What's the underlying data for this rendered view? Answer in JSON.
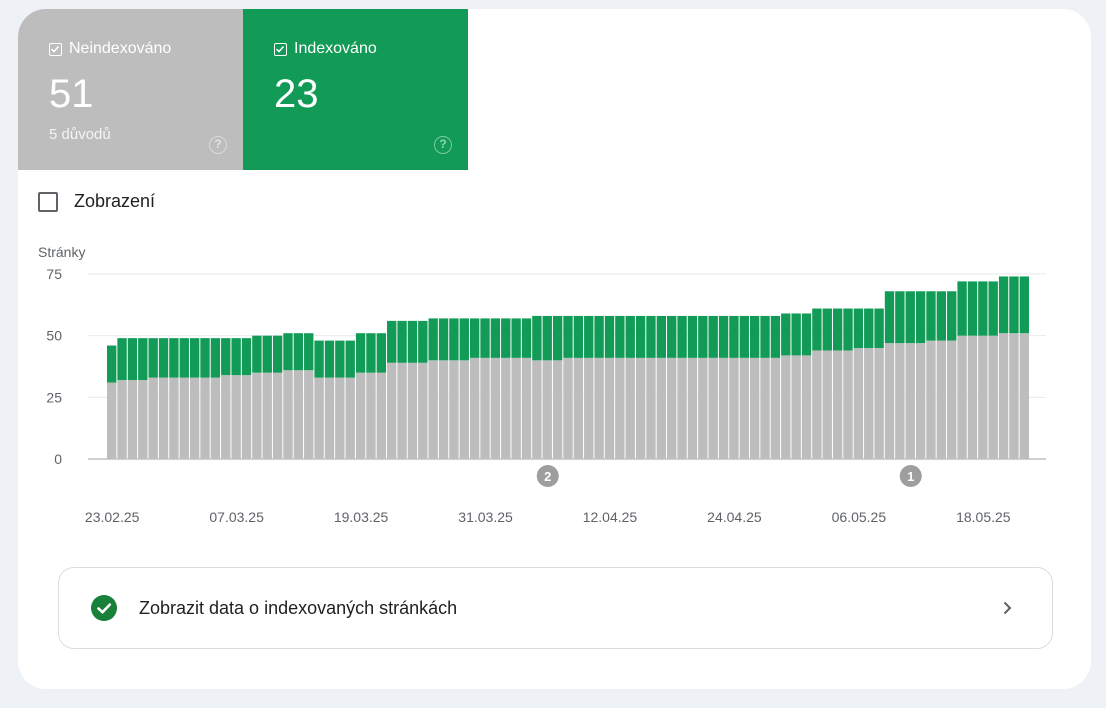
{
  "tiles": {
    "not_indexed": {
      "label": "Neindexováno",
      "value": "51",
      "sub": "5 důvodů",
      "help": "?",
      "checked": true
    },
    "indexed": {
      "label": "Indexováno",
      "value": "23",
      "help": "?",
      "checked": true
    }
  },
  "impressions_toggle": {
    "label": "Zobrazení",
    "checked": false
  },
  "colors": {
    "not_indexed": "#bdbdbd",
    "indexed": "#129b57",
    "grid": "#e8eaed",
    "axis": "#9aa0a6",
    "marker": "#9e9e9e"
  },
  "chart_data": {
    "type": "bar",
    "stacked": true,
    "ylabel": "Stránky",
    "ylim": [
      0,
      75
    ],
    "yticks": [
      0,
      25,
      50,
      75
    ],
    "xtick_labels": [
      "23.02.25",
      "07.03.25",
      "19.03.25",
      "31.03.25",
      "12.04.25",
      "24.04.25",
      "06.05.25",
      "18.05.25"
    ],
    "first_date": "2025-02-23",
    "last_date": "2025-05-21",
    "series": [
      {
        "name": "Neindexováno",
        "values": [
          31,
          32,
          32,
          32,
          33,
          33,
          33,
          33,
          33,
          33,
          33,
          34,
          34,
          34,
          35,
          35,
          35,
          36,
          36,
          36,
          33,
          33,
          33,
          33,
          35,
          35,
          35,
          39,
          39,
          39,
          39,
          40,
          40,
          40,
          40,
          41,
          41,
          41,
          41,
          41,
          41,
          40,
          40,
          40,
          41,
          41,
          41,
          41,
          41,
          41,
          41,
          41,
          41,
          41,
          41,
          41,
          41,
          41,
          41,
          41,
          41,
          41,
          41,
          41,
          41,
          42,
          42,
          42,
          44,
          44,
          44,
          44,
          45,
          45,
          45,
          47,
          47,
          47,
          47,
          48,
          48,
          48,
          50,
          50,
          50,
          50,
          51,
          51,
          51
        ]
      },
      {
        "name": "Indexováno",
        "values": [
          15,
          17,
          17,
          17,
          16,
          16,
          16,
          16,
          16,
          16,
          16,
          15,
          15,
          15,
          15,
          15,
          15,
          15,
          15,
          15,
          15,
          15,
          15,
          15,
          16,
          16,
          16,
          17,
          17,
          17,
          17,
          17,
          17,
          17,
          17,
          16,
          16,
          16,
          16,
          16,
          16,
          18,
          18,
          18,
          17,
          17,
          17,
          17,
          17,
          17,
          17,
          17,
          17,
          17,
          17,
          17,
          17,
          17,
          17,
          17,
          17,
          17,
          17,
          17,
          17,
          17,
          17,
          17,
          17,
          17,
          17,
          17,
          16,
          16,
          16,
          21,
          21,
          21,
          21,
          20,
          20,
          20,
          22,
          22,
          22,
          22,
          23,
          23,
          23
        ]
      }
    ],
    "annotations": [
      {
        "label": "2",
        "date": "2025-04-06"
      },
      {
        "label": "1",
        "date": "2025-05-11"
      }
    ]
  },
  "detail_link": {
    "label": "Zobrazit data o indexovaných stránkách"
  }
}
